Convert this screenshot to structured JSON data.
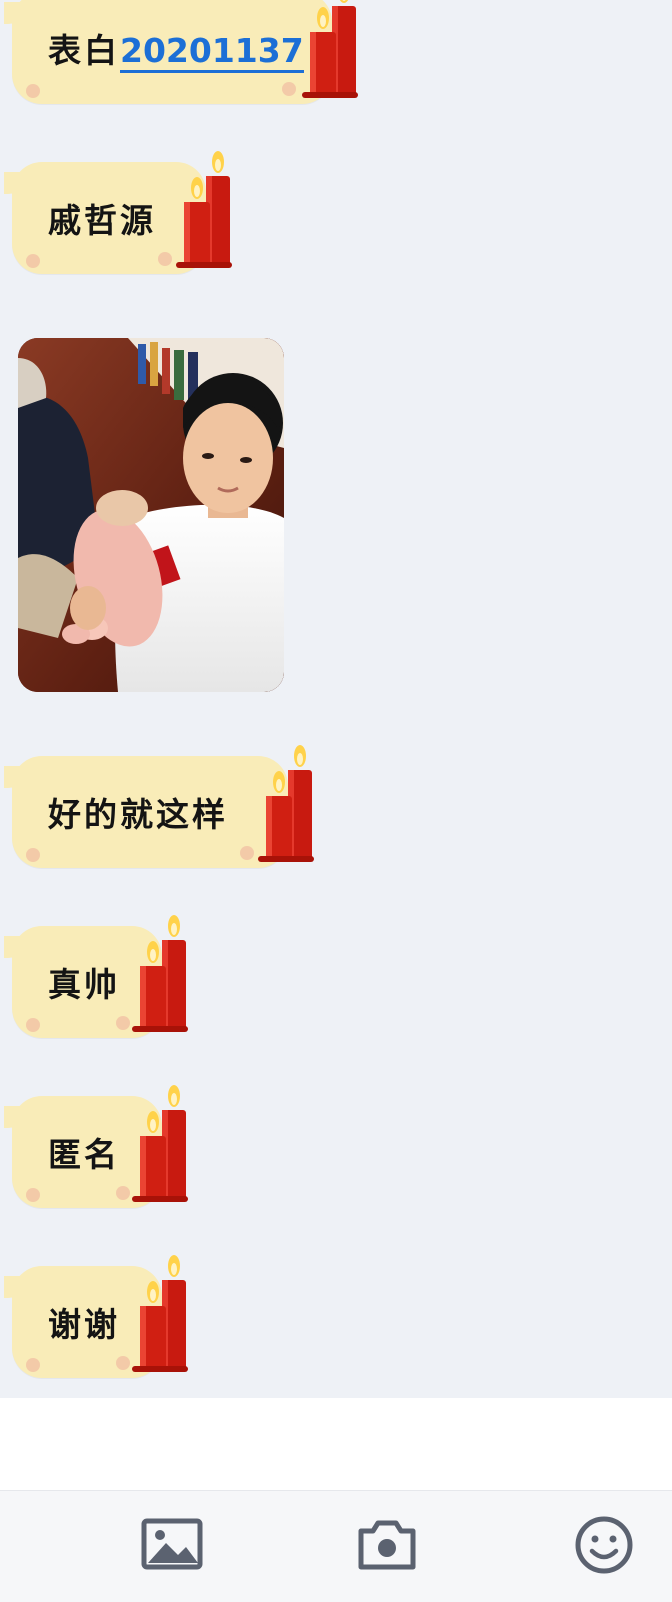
{
  "messages": [
    {
      "id": "m1",
      "text": "表白",
      "number": "20201137"
    },
    {
      "id": "m2",
      "text": "戚哲源"
    },
    {
      "id": "m3",
      "type": "image",
      "image": "selfie-photo"
    },
    {
      "id": "m4",
      "text": "好的就这样"
    },
    {
      "id": "m5",
      "text": "真帅"
    },
    {
      "id": "m6",
      "text": "匿名"
    },
    {
      "id": "m7",
      "text": "谢谢"
    }
  ],
  "toolbar": {
    "items": [
      {
        "name": "image-icon"
      },
      {
        "name": "camera-icon"
      },
      {
        "name": "emoji-icon"
      }
    ]
  },
  "colors": {
    "background": "#eef1f6",
    "bubble": "#f9ecb8",
    "candle": "#d01f12",
    "link_number": "#1c6fd6"
  }
}
